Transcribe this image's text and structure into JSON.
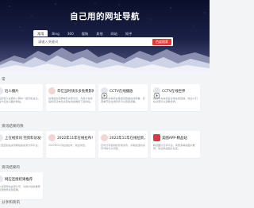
{
  "header": {
    "site_title": "自己用的网址导航",
    "search": {
      "tabs": [
        "常用",
        "Bing",
        "360",
        "搜狗",
        "其他",
        "网站",
        "知乎"
      ],
      "active_tab": "常用",
      "placeholder": "请输入关键词",
      "button_label": "百度搜索"
    }
  },
  "sections": [
    {
      "title": "常",
      "cards": [
        {
          "title": "近人播片",
          "desc": "人社区有人在更新人群中一起手机关注，来提升自身兴趣的网站。",
          "icon": "card-icon"
        },
        {
          "title": "年忆当时快乐多免费影网站",
          "desc": "追溯逝去经典电影资源平台，为用户免费提供高清电影资源在线观看和下载网站。",
          "icon": "red-circle-icon"
        },
        {
          "title": "CCTV在线播放",
          "desc": "提供中央电视台各频道直播在线观看，另观看节目在线同步可以直接观看。",
          "icon": "play-icon"
        },
        {
          "title": "CCTV在线世界",
          "desc": "提供中央电视台全球在线直播，欢迎人们在这里可以观看世界。",
          "icon": "play-icon"
        }
      ]
    },
    {
      "title": "资讯结果的快",
      "cards": [
        {
          "title": "上在线资讯 完资料访发验证",
          "desc": "一个直连到在资源网站的资源分享平台。",
          "icon": "card-icon"
        },
        {
          "title": "2022年11年在线拉布！",
          "desc": "2022年11月在线拉布，欢迎浏览。",
          "icon": "red-circle-icon"
        },
        {
          "title": "2022年11年在线拉新，最近期相关...",
          "desc": "定时分享最新的影视资讯，共有最佳的资讯详情可以浏览。",
          "icon": "red-circle-icon"
        },
        {
          "title": "美图APP-精品站",
          "desc": "精选图片分享平台，有更多精彩图片推荐，欢迎来此图片社区。",
          "icon": "red-square-icon"
        }
      ]
    },
    {
      "title": "资讯结果的",
      "cards": [
        {
          "title": "网应连接结果推荐",
          "desc": "不少资源网站资源分享，为用户提供推荐的资源推荐资源结果。",
          "icon": "card-icon"
        }
      ]
    },
    {
      "title": "分享和资讯",
      "cards": []
    }
  ]
}
